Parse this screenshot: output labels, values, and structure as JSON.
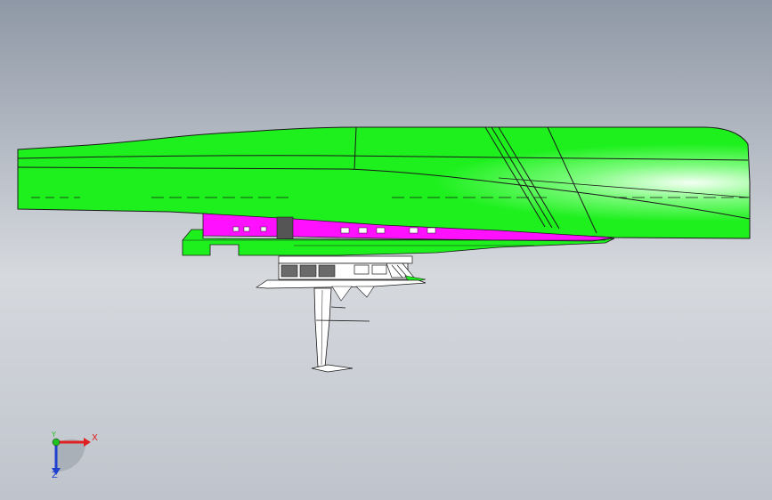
{
  "viewport": {
    "background_top": "#8f98a6",
    "background_mid": "#d6d9de",
    "background_bottom": "#bfc4cc"
  },
  "model": {
    "colors": {
      "hull_green": "#1ef01e",
      "hull_highlight": "#e8ffe8",
      "hull_dark": "#12c012",
      "cabin_magenta": "#ff10ff",
      "structure_white": "#ffffff",
      "outline": "#1a1a1a",
      "window_gray": "#6a6a6a"
    }
  },
  "triad": {
    "x_label": "X",
    "y_label": "Y",
    "z_label": "Z",
    "x_color": "#e02020",
    "y_color": "#20c020",
    "z_color": "#2040d0",
    "icon": "coordinate-triad-icon"
  }
}
